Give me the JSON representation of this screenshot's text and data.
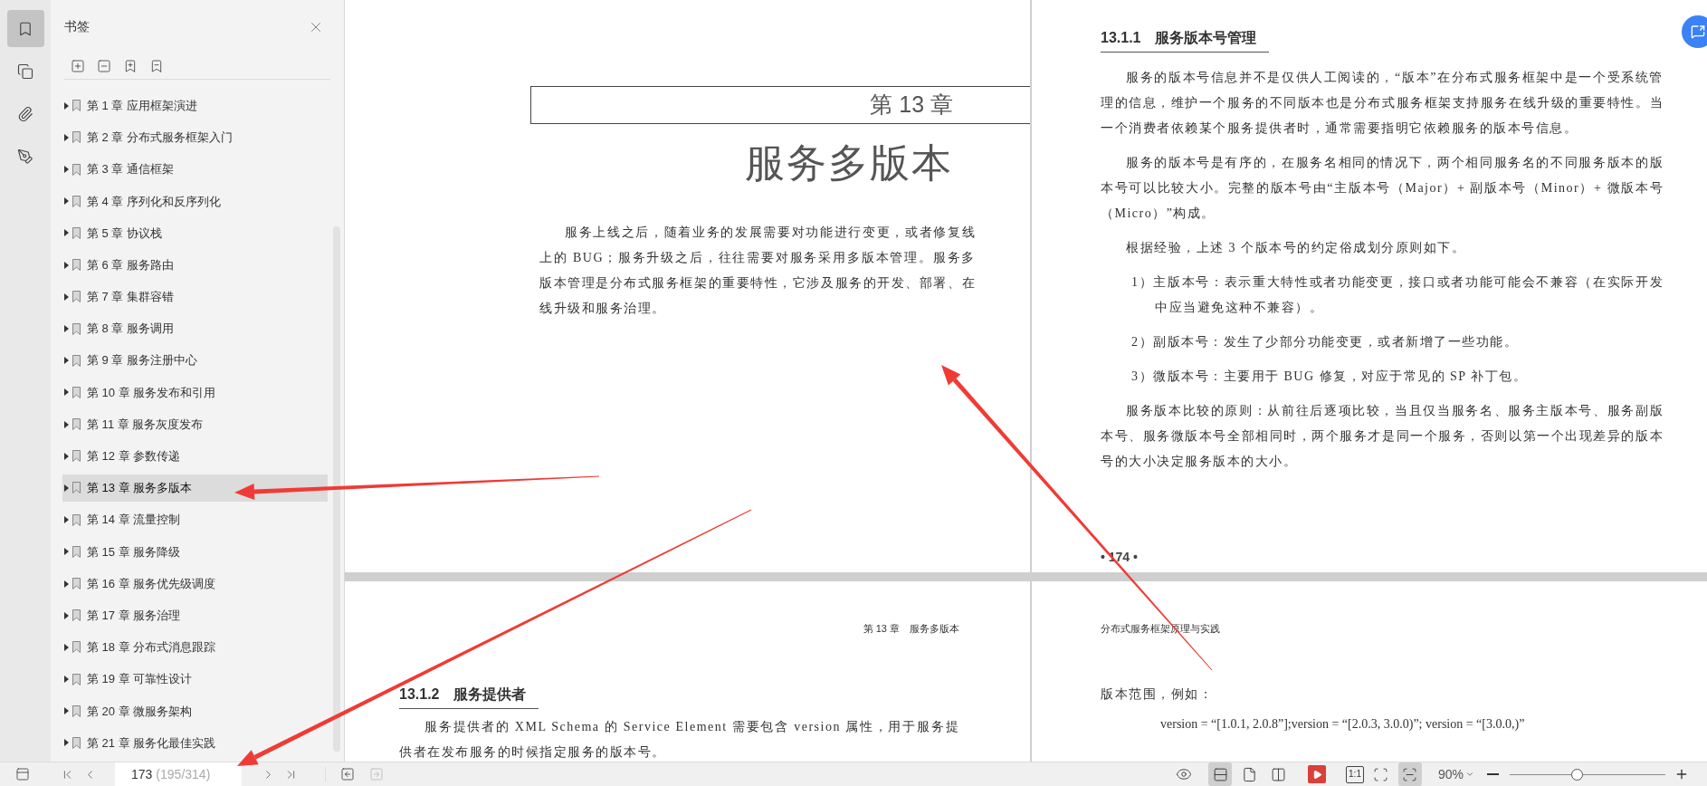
{
  "rail": [
    {
      "kind": "bookmarks",
      "selected": true
    },
    {
      "kind": "thumbnails",
      "selected": false
    },
    {
      "kind": "attachments",
      "selected": false
    },
    {
      "kind": "signatures",
      "selected": false
    }
  ],
  "sidebar": {
    "title": "书签",
    "items": [
      {
        "label": "第 1 章 应用框架演进",
        "selected": false
      },
      {
        "label": "第 2 章 分布式服务框架入门",
        "selected": false
      },
      {
        "label": "第 3 章 通信框架",
        "selected": false
      },
      {
        "label": "第 4 章 序列化和反序列化",
        "selected": false
      },
      {
        "label": "第 5 章 协议栈",
        "selected": false
      },
      {
        "label": "第 6 章 服务路由",
        "selected": false
      },
      {
        "label": "第 7 章 集群容错",
        "selected": false
      },
      {
        "label": "第 8 章 服务调用",
        "selected": false
      },
      {
        "label": "第 9 章 服务注册中心",
        "selected": false
      },
      {
        "label": "第 10 章 服务发布和引用",
        "selected": false
      },
      {
        "label": "第 11 章 服务灰度发布",
        "selected": false
      },
      {
        "label": "第 12 章 参数传递",
        "selected": false
      },
      {
        "label": "第 13 章 服务多版本",
        "selected": true
      },
      {
        "label": "第 14 章 流量控制",
        "selected": false
      },
      {
        "label": "第 15 章 服务降级",
        "selected": false
      },
      {
        "label": "第 16 章 服务优先级调度",
        "selected": false
      },
      {
        "label": "第 17 章 服务治理",
        "selected": false
      },
      {
        "label": "第 18 章 分布式消息跟踪",
        "selected": false
      },
      {
        "label": "第 19 章 可靠性设计",
        "selected": false
      },
      {
        "label": "第 20 章 微服务架构",
        "selected": false
      },
      {
        "label": "第 21 章 服务化最佳实践",
        "selected": false
      }
    ]
  },
  "pages": {
    "top_left": {
      "chapter_label": "第 13 章",
      "chapter_title": "服务多版本",
      "paragraph": "服务上线之后，随着业务的发展需要对功能进行变更，或者修复线上的 BUG；服务升级之后，往往需要对服务采用多版本管理。服务多版本管理是分布式服务框架的重要特性，它涉及服务的开发、部署、在线升级和服务治理。"
    },
    "top_right": {
      "heading": "13.1.1　服务版本号管理",
      "paragraphs": [
        {
          "kind": "para",
          "text": "服务的版本号信息并不是仅供人工阅读的，“版本”在分布式服务框架中是一个受系统管理的信息，维护一个服务的不同版本也是分布式服务框架支持服务在线升级的重要特性。当一个消费者依赖某个服务提供者时，通常需要指明它依赖服务的版本号信息。"
        },
        {
          "kind": "para",
          "text": "服务的版本号是有序的，在服务名相同的情况下，两个相同服务名的不同服务版本的版本号可以比较大小。完整的版本号由“主版本号（Major）+ 副版本号（Minor）+ 微版本号（Micro）”构成。"
        },
        {
          "kind": "para",
          "text": "根据经验，上述 3 个版本号的约定俗成划分原则如下。"
        },
        {
          "kind": "item",
          "text": "1）主版本号：表示重大特性或者功能变更，接口或者功能可能会不兼容（在实际开发中应当避免这种不兼容）。"
        },
        {
          "kind": "item",
          "text": "2）副版本号：发生了少部分功能变更，或者新增了一些功能。"
        },
        {
          "kind": "item",
          "text": "3）微版本号：主要用于 BUG 修复，对应于常见的 SP 补丁包。"
        },
        {
          "kind": "para",
          "text": "服务版本比较的原则：从前往后逐项比较，当且仅当服务名、服务主版本号、服务副版本号、服务微版本号全部相同时，两个服务才是同一个服务，否则以第一个出现差异的版本号的大小决定服务版本的大小。"
        }
      ],
      "page_number": "• 174 •"
    },
    "bottom_left": {
      "running_head": "第 13 章　服务多版本",
      "heading": "13.1.2　服务提供者",
      "paragraph": "服务提供者的 XML Schema 的 Service Element 需要包含 version 属性，用于服务提供者在发布服务的时候指定服务的版本号。"
    },
    "bottom_right": {
      "running_head": "分布式服务框架原理与实践",
      "paragraphs": [
        {
          "kind": "para",
          "text": "版本范围，例如："
        },
        {
          "kind": "code",
          "text": "version = “[1.0.1, 2.0.8”];version = “[2.0.3, 3.0.0)”; version = “[3.0.0,)”"
        }
      ]
    }
  },
  "toolbar": {
    "page_number": "173",
    "page_total": "(195/314)",
    "view_modes": [
      {
        "kind": "continuous",
        "selected": true
      },
      {
        "kind": "single",
        "selected": false
      },
      {
        "kind": "facing",
        "selected": false
      }
    ],
    "actual_size_label": "1:1",
    "fit_modes": [
      {
        "kind": "page",
        "selected": false
      },
      {
        "kind": "width",
        "selected": true
      }
    ],
    "zoom": "90%",
    "zoom_slider": {
      "level": 0.43
    }
  }
}
